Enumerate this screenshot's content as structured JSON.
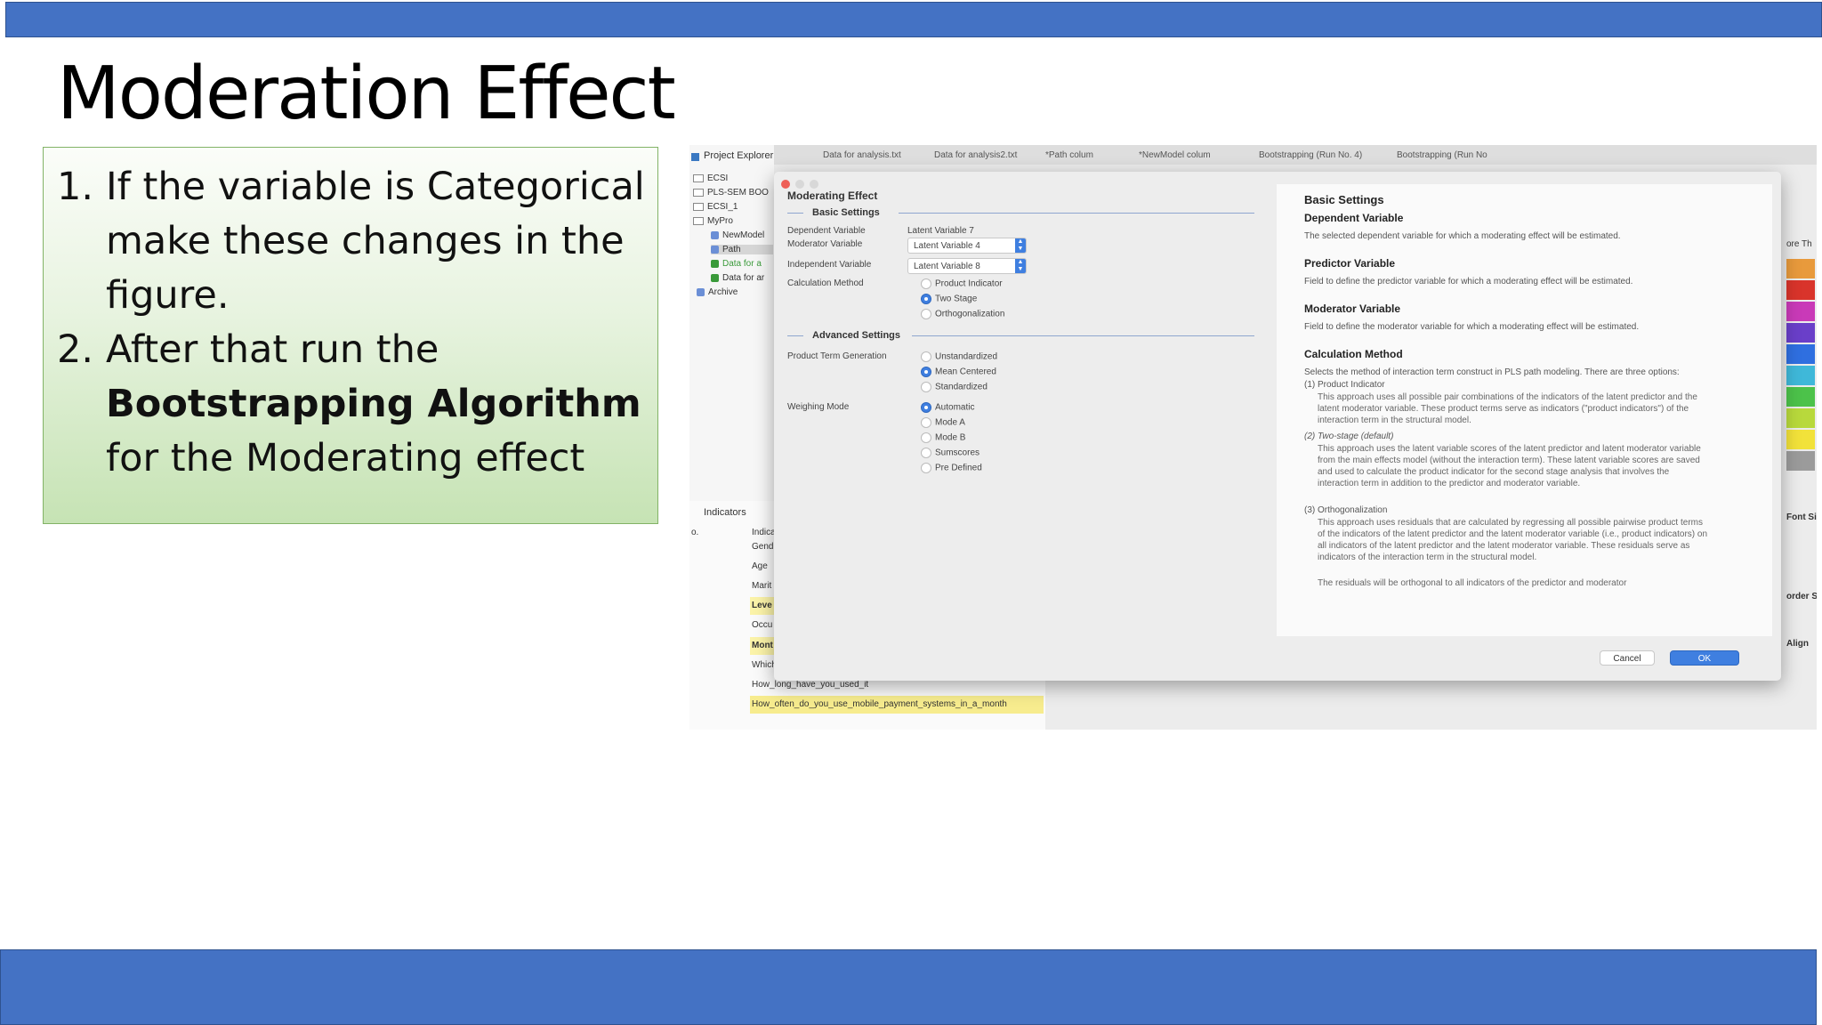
{
  "slide": {
    "title": "Moderation Effect",
    "items": [
      {
        "num": "1.",
        "text": "If the variable is Categorical make these changes in the figure."
      },
      {
        "num": "2.",
        "pre": "After that run the ",
        "bold": "Bootstrapping Algorithm",
        "post": " for the Moderating effect"
      }
    ]
  },
  "colors": {
    "bar": "#4472c4",
    "accent": "#3f7fe0"
  },
  "app": {
    "explorer_title": "Project Explorer",
    "tree": [
      "ECSI",
      "PLS-SEM BOO",
      "ECSI_1",
      "MyPro",
      "NewModel",
      "Path",
      "Data for a",
      "Data for ar",
      "Archive"
    ],
    "tabs": [
      "Data for analysis.txt",
      "Data for analysis2.txt",
      "*Path colum",
      "*NewModel colum",
      "Bootstrapping (Run No. 4)",
      "Bootstrapping (Run No"
    ],
    "indicators_title": "Indicators",
    "indicators_col": "o.",
    "indicator_rows": [
      "Indica",
      "Gend",
      "Age",
      "Marit",
      "Leve",
      "Occu",
      "Mont",
      "Which",
      "How_long_have_you_used_it",
      "How_often_do_you_use_mobile_payment_systems_in_a_month"
    ],
    "side_labels": [
      "ore Th",
      "Font Si",
      "order S",
      "Align"
    ]
  },
  "dialog": {
    "title": "Moderating Effect",
    "basic_settings": "Basic Settings",
    "dependent_label": "Dependent Variable",
    "dependent_value": "Latent Variable 7",
    "moderator_label": "Moderator Variable",
    "moderator_value": "Latent Variable 4",
    "independent_label": "Independent Variable",
    "independent_value": "Latent Variable 8",
    "calc_label": "Calculation Method",
    "calc_options": [
      "Product Indicator",
      "Two Stage",
      "Orthogonalization"
    ],
    "calc_selected": "Two Stage",
    "advanced_settings": "Advanced Settings",
    "product_term_label": "Product Term Generation",
    "product_term_options": [
      "Unstandardized",
      "Mean Centered",
      "Standardized"
    ],
    "product_term_selected": "Mean Centered",
    "weighting_label": "Weighing Mode",
    "weighting_options": [
      "Automatic",
      "Mode A",
      "Mode B",
      "Sumscores",
      "Pre Defined"
    ],
    "weighting_selected": "Automatic",
    "cancel": "Cancel",
    "ok": "OK"
  },
  "help": {
    "heading": "Basic Settings",
    "dep_title": "Dependent Variable",
    "dep_text": "The selected dependent variable for which a moderating effect will be estimated.",
    "pred_title": "Predictor Variable",
    "pred_text": "Field to define the predictor variable for which a moderating effect will be estimated.",
    "mod_title": "Moderator Variable",
    "mod_text": "Field to define the moderator variable for which a moderating effect will be estimated.",
    "calc_title": "Calculation Method",
    "calc_text": "Selects the method of interaction term construct in PLS path modeling. There are three options:",
    "opt1_title": "(1) Product Indicator",
    "opt1_text": "This approach uses all possible pair combinations of the indicators of the latent predictor and the latent moderator variable. These product terms serve as indicators (\"product indicators\") of the interaction term in the structural model.",
    "opt2_title": "(2) Two-stage (default)",
    "opt2_text": "This approach uses the latent variable scores of the latent predictor and latent moderator variable from the main effects model (without the interaction term). These latent variable scores are saved and used to calculate the product indicator for the second stage analysis that involves the interaction term in addition to the predictor and moderator variable.",
    "opt3_title": "(3) Orthogonalization",
    "opt3_text": "This approach uses residuals that are calculated by regressing all possible pairwise product terms of the indicators of the latent predictor and the latent moderator variable (i.e., product indicators) on all indicators of the latent predictor and the latent moderator variable. These residuals serve as indicators of the interaction term in the structural model.",
    "opt3_text2": "The residuals will be orthogonal to all indicators of the predictor and moderator"
  }
}
